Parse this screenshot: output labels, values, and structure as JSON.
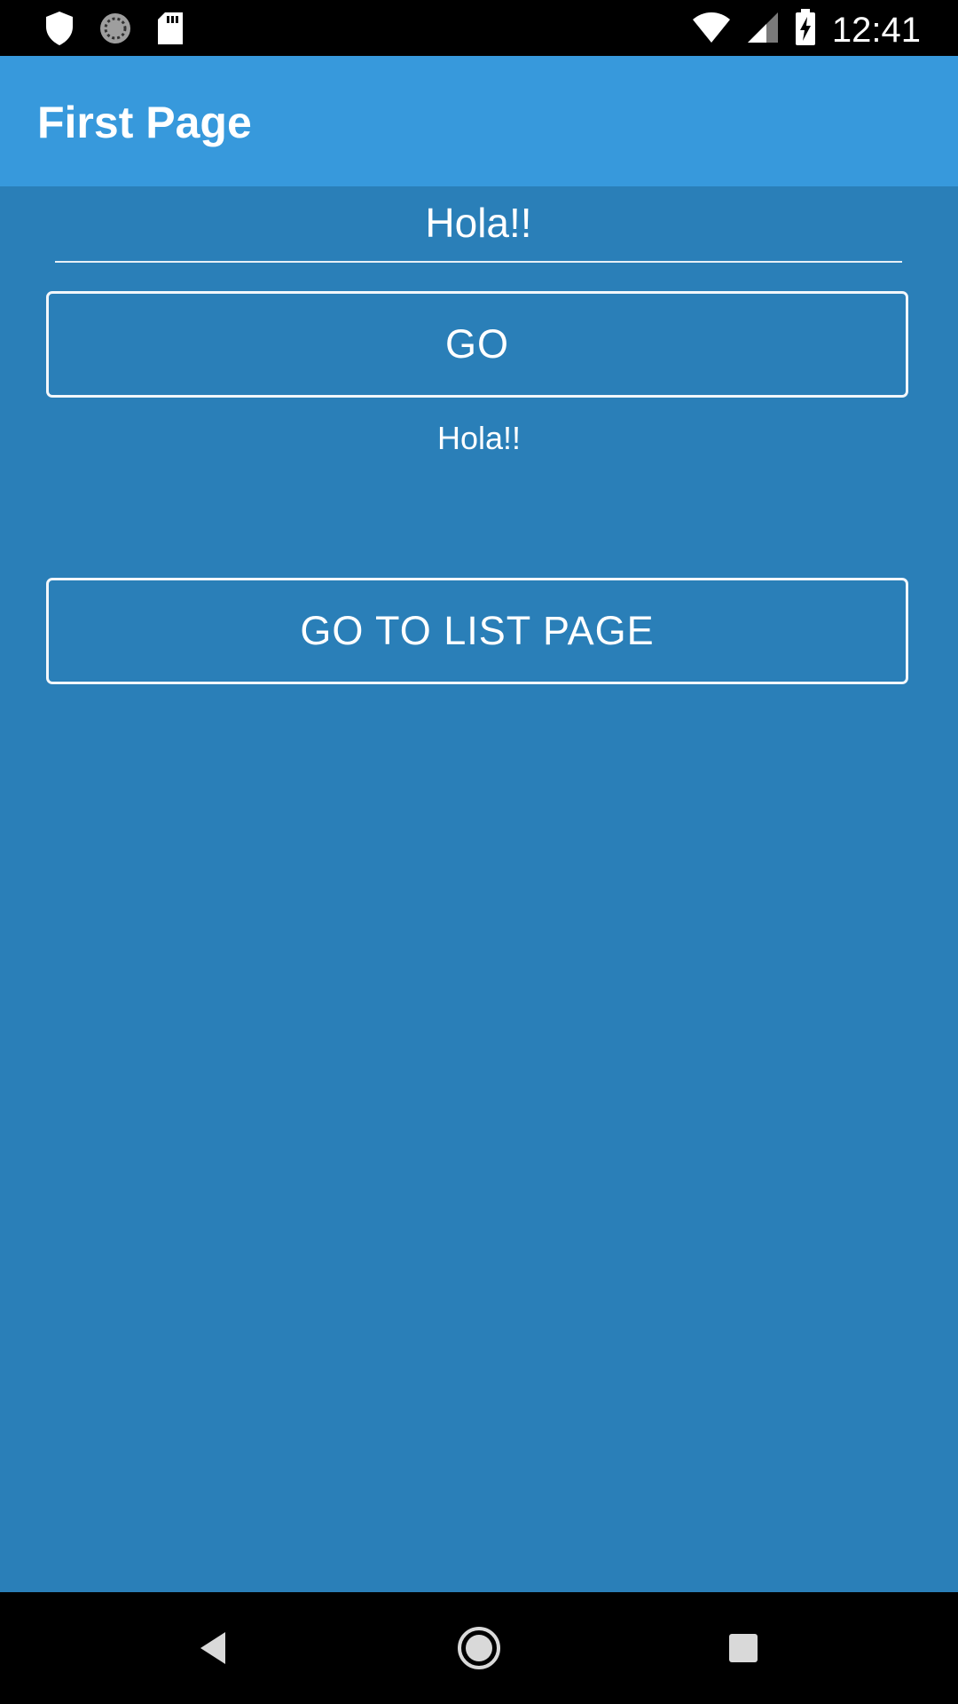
{
  "status_bar": {
    "time": "12:41",
    "icons": [
      "shield-icon",
      "sync-icon",
      "sd-card-icon",
      "wifi-icon",
      "signal-icon",
      "battery-charging-icon"
    ]
  },
  "app_bar": {
    "title": "First Page",
    "background": "#3799dc"
  },
  "main": {
    "background": "#2a7fb8",
    "text_input": {
      "value": "Hola!!"
    },
    "go_button": {
      "label": "GO"
    },
    "echo_text": "Hola!!",
    "list_button": {
      "label": "GO TO LIST PAGE"
    }
  },
  "nav_bar": {
    "buttons": [
      "back-icon",
      "home-icon",
      "recent-apps-icon"
    ]
  }
}
